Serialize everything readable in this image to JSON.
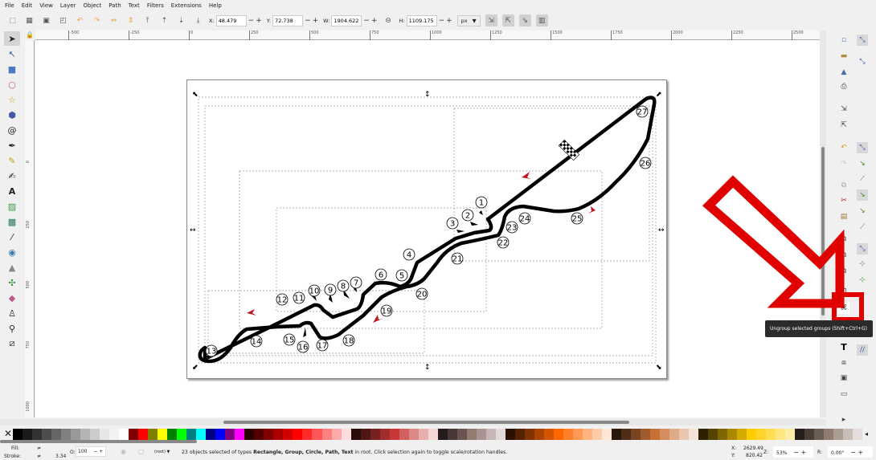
{
  "menu": [
    "File",
    "Edit",
    "View",
    "Layer",
    "Object",
    "Path",
    "Text",
    "Filters",
    "Extensions",
    "Help"
  ],
  "toolbar": {
    "x_label": "X:",
    "x": "48.479",
    "y_label": "Y:",
    "y": "72.738",
    "w_label": "W:",
    "w": "1904.622",
    "h_label": "H:",
    "h": "1109.175",
    "unit": "px"
  },
  "ruler": {
    "h": [
      "-500",
      "-250",
      "0",
      "250",
      "500",
      "750",
      "1000",
      "1250",
      "1500",
      "1750",
      "2000",
      "2250",
      "2500"
    ],
    "v": [
      "0",
      "250",
      "500",
      "750",
      "1000"
    ]
  },
  "track": {
    "turns": [
      "1",
      "2",
      "3",
      "4",
      "5",
      "6",
      "7",
      "8",
      "9",
      "10",
      "11",
      "12",
      "13",
      "14",
      "15",
      "16",
      "17",
      "18",
      "19",
      "20",
      "21",
      "22",
      "23",
      "24",
      "25",
      "26",
      "27"
    ]
  },
  "tooltip": "Ungroup selected groups (Shift+Ctrl+G)",
  "palette": [
    "#000",
    "#1a1a1a",
    "#333",
    "#4d4d4d",
    "#666",
    "#808080",
    "#999",
    "#b3b3b3",
    "#ccc",
    "#e6e6e6",
    "#f2f2f2",
    "#fff",
    "#800000",
    "#f00",
    "#808000",
    "#ff0",
    "#008000",
    "#0f0",
    "#008080",
    "#0ff",
    "#000080",
    "#00f",
    "#800080",
    "#f0f",
    "#2b0000",
    "#550000",
    "#800000",
    "#aa0000",
    "#d40000",
    "#f00",
    "#ff2a2a",
    "#f55",
    "#ff8080",
    "#faa",
    "#fdd",
    "#280b0b",
    "#501616",
    "#782121",
    "#a02c2c",
    "#c83737",
    "#d35f5f",
    "#de8787",
    "#e9afaf",
    "#f4d7d7",
    "#241c1c",
    "#483737",
    "#6c5353",
    "#917c6f",
    "#ac9393",
    "#c8b7b7",
    "#e3dbdb",
    "#2b1100",
    "#552200",
    "#803300",
    "#a40",
    "#d45500",
    "#f60",
    "#ff7f2a",
    "#f95",
    "#ffb380",
    "#fca",
    "#ffe6d5",
    "#28170b",
    "#502d16",
    "#784421",
    "#a05a2c",
    "#c87137",
    "#d38d5f",
    "#deaa87",
    "#e9c6af",
    "#f4e3d7",
    "#2b2200",
    "#554400",
    "#806600",
    "#a80",
    "#d4aa00",
    "#fc0",
    "#ffd42a",
    "#fd5",
    "#ffe680",
    "#fea",
    "#241f1c",
    "#483e37",
    "#6c5d53",
    "#917c6f",
    "#ac9d93",
    "#c8beb7",
    "#e3dedb"
  ],
  "status": {
    "fill_label": "Fill:",
    "stroke_label": "Stroke:",
    "fill_value": "≠",
    "stroke_value": "≠",
    "stroke_width": "3.34",
    "opacity_label": "O:",
    "opacity": "100",
    "layer": "(root)",
    "message_pre": "23 objects selected of types ",
    "types": "Rectangle, Group, Circle, Path, Text",
    "message_post": " in root. Click selection again to toggle scale/rotation handles.",
    "cursor_x_label": "X:",
    "cursor_x": "2629.49",
    "cursor_y_label": "Y:",
    "cursor_y": "820.42",
    "zoom_label": "Z:",
    "zoom": "53%",
    "rotation_label": "R:",
    "rotation": "0.00°"
  },
  "colors": {
    "highlight": "#e00000",
    "arrow": "#c0121b"
  }
}
